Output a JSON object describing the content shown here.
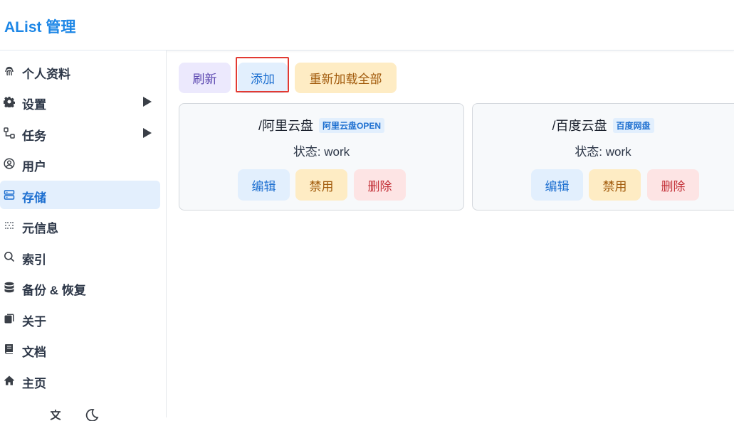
{
  "header": {
    "title": "AList 管理"
  },
  "sidebar": {
    "items": [
      {
        "label": "个人资料",
        "icon": "fingerprint-icon"
      },
      {
        "label": "设置",
        "icon": "gear-icon",
        "expandable": true
      },
      {
        "label": "任务",
        "icon": "tasks-icon",
        "expandable": true
      },
      {
        "label": "用户",
        "icon": "user-icon"
      },
      {
        "label": "存储",
        "icon": "storage-icon",
        "active": true
      },
      {
        "label": "元信息",
        "icon": "metadata-icon"
      },
      {
        "label": "索引",
        "icon": "search-icon"
      },
      {
        "label": "备份 & 恢复",
        "icon": "database-icon"
      },
      {
        "label": "关于",
        "icon": "copy-icon"
      },
      {
        "label": "文档",
        "icon": "book-icon"
      },
      {
        "label": "主页",
        "icon": "home-icon"
      }
    ]
  },
  "toolbar": {
    "refresh_label": "刷新",
    "add_label": "添加",
    "reload_all_label": "重新加载全部"
  },
  "storages": [
    {
      "mount_path": "/阿里云盘",
      "driver": "阿里云盘OPEN",
      "status_label": "状态:",
      "status_value": "work",
      "edit_label": "编辑",
      "disable_label": "禁用",
      "delete_label": "删除"
    },
    {
      "mount_path": "/百度云盘",
      "driver": "百度网盘",
      "status_label": "状态:",
      "status_value": "work",
      "edit_label": "编辑",
      "disable_label": "禁用",
      "delete_label": "删除"
    }
  ],
  "colors": {
    "brand": "#1c86e6",
    "active_bg": "#e3effd",
    "highlight": "#e23a32"
  }
}
